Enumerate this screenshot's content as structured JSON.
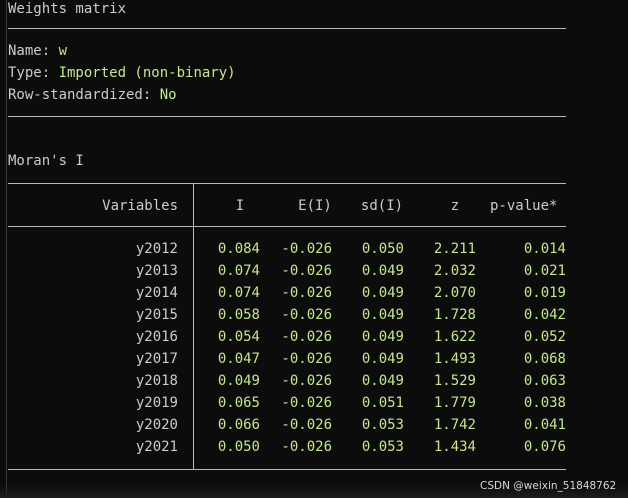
{
  "weights": {
    "title": "Weights matrix",
    "name_label": "Name: ",
    "name_value": "w",
    "type_label": "Type: ",
    "type_value": "Imported (non-binary)",
    "rowstd_label": "Row-standardized: ",
    "rowstd_value": "No"
  },
  "moran": {
    "title": "Moran's I",
    "headers": [
      "Variables",
      "I",
      "E(I)",
      "sd(I)",
      "z",
      "p-value*"
    ],
    "rows": [
      [
        "y2012",
        "0.084",
        "-0.026",
        "0.050",
        "2.211",
        "0.014"
      ],
      [
        "y2013",
        "0.074",
        "-0.026",
        "0.049",
        "2.032",
        "0.021"
      ],
      [
        "y2014",
        "0.074",
        "-0.026",
        "0.049",
        "2.070",
        "0.019"
      ],
      [
        "y2015",
        "0.058",
        "-0.026",
        "0.049",
        "1.728",
        "0.042"
      ],
      [
        "y2016",
        "0.054",
        "-0.026",
        "0.049",
        "1.622",
        "0.052"
      ],
      [
        "y2017",
        "0.047",
        "-0.026",
        "0.049",
        "1.493",
        "0.068"
      ],
      [
        "y2018",
        "0.049",
        "-0.026",
        "0.049",
        "1.529",
        "0.063"
      ],
      [
        "y2019",
        "0.065",
        "-0.026",
        "0.051",
        "1.779",
        "0.038"
      ],
      [
        "y2020",
        "0.066",
        "-0.026",
        "0.053",
        "1.742",
        "0.041"
      ],
      [
        "y2021",
        "0.050",
        "-0.026",
        "0.053",
        "1.434",
        "0.076"
      ]
    ]
  },
  "watermark": "CSDN @weixin_51848762",
  "colors": {
    "background": "#0c0c0c",
    "text": "#cccccc",
    "value_green": "#c3e88d",
    "rule": "#b9b9b9"
  }
}
